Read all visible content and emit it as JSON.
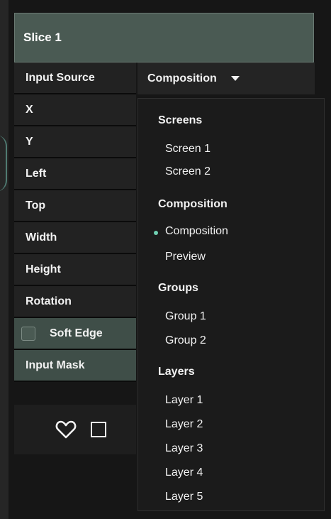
{
  "header": {
    "title": "Slice 1"
  },
  "properties": [
    {
      "label": "Input Source"
    },
    {
      "label": "X"
    },
    {
      "label": "Y"
    },
    {
      "label": "Left"
    },
    {
      "label": "Top"
    },
    {
      "label": "Width"
    },
    {
      "label": "Height"
    },
    {
      "label": "Rotation"
    }
  ],
  "soft_edge": {
    "label": "Soft Edge",
    "checked": false
  },
  "input_mask": {
    "label": "Input Mask"
  },
  "select": {
    "value": "Composition"
  },
  "dropdown": {
    "groups": [
      {
        "heading": "Screens",
        "items": [
          "Screen 1",
          "Screen 2"
        ]
      },
      {
        "heading": "Composition",
        "items": [
          "Composition",
          "Preview"
        ],
        "selected": "Composition"
      },
      {
        "heading": "Groups",
        "items": [
          "Group 1",
          "Group 2"
        ]
      },
      {
        "heading": "Layers",
        "items": [
          "Layer 1",
          "Layer 2",
          "Layer 3",
          "Layer 4",
          "Layer 5"
        ]
      }
    ]
  },
  "icons": {
    "favorite": "heart-icon",
    "square": "square-icon"
  },
  "colors": {
    "accent": "#6fd0b2",
    "header_bg": "#4a5a53"
  }
}
